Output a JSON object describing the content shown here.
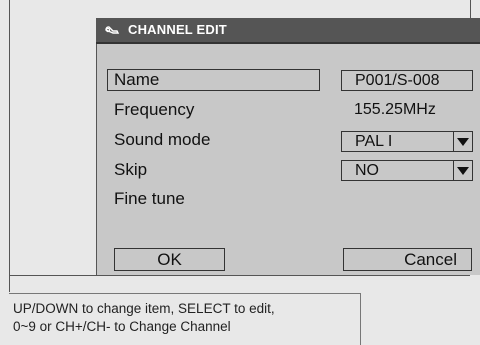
{
  "dialog": {
    "title": "CHANNEL EDIT",
    "icon": "wrench-icon"
  },
  "fields": {
    "name": {
      "label": "Name",
      "value": "P001/S-008"
    },
    "frequency": {
      "label": "Frequency",
      "value": "155.25MHz"
    },
    "sound_mode": {
      "label": "Sound mode",
      "value": "PAL I"
    },
    "skip": {
      "label": "Skip",
      "value": "NO"
    },
    "fine_tune": {
      "label": "Fine tune"
    }
  },
  "buttons": {
    "ok": "OK",
    "cancel": "Cancel"
  },
  "status": {
    "line1": "UP/DOWN to change item, SELECT to edit,",
    "line2": "0~9 or CH+/CH- to Change Channel"
  },
  "colors": {
    "title_bar": "#555555",
    "dialog_bg": "#c8c8c8",
    "screen_bg": "#e8e8e8"
  }
}
